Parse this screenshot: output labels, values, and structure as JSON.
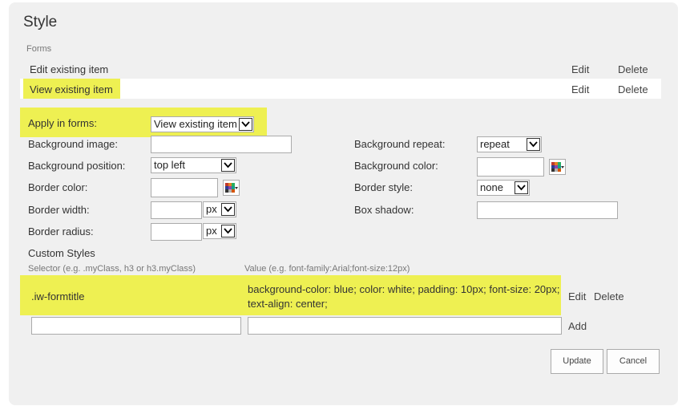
{
  "title": "Style",
  "forms_label": "Forms",
  "forms": [
    {
      "name": "Edit existing item",
      "edit": "Edit",
      "delete": "Delete"
    },
    {
      "name": "View existing item",
      "edit": "Edit",
      "delete": "Delete"
    }
  ],
  "apply_in_forms": {
    "label": "Apply in forms:",
    "value": "View existing item"
  },
  "fields": {
    "background_image": {
      "label": "Background image:",
      "value": ""
    },
    "background_position": {
      "label": "Background position:",
      "value": "top left"
    },
    "border_color": {
      "label": "Border color:",
      "value": ""
    },
    "border_width": {
      "label": "Border width:",
      "value": "",
      "unit": "px"
    },
    "border_radius": {
      "label": "Border radius:",
      "value": "",
      "unit": "px"
    },
    "background_repeat": {
      "label": "Background repeat:",
      "value": "repeat"
    },
    "background_color": {
      "label": "Background color:",
      "value": ""
    },
    "border_style": {
      "label": "Border style:",
      "value": "none"
    },
    "box_shadow": {
      "label": "Box shadow:",
      "value": ""
    }
  },
  "custom_styles": {
    "heading": "Custom Styles",
    "selector_hint": "Selector (e.g. .myClass, h3 or h3.myClass)",
    "value_hint": "Value (e.g. font-family:Arial;font-size:12px)",
    "rows": [
      {
        "selector": ".iw-formtitle",
        "value_line1": "background-color: blue; color: white; padding: 10px; font-size: 20px;",
        "value_line2": "text-align: center;",
        "edit": "Edit",
        "delete": "Delete"
      }
    ],
    "new_selector": "",
    "new_value": "",
    "add_label": "Add"
  },
  "buttons": {
    "update": "Update",
    "cancel": "Cancel"
  },
  "colors": {
    "highlight": "#eef052",
    "panel": "#f0f0f0"
  }
}
